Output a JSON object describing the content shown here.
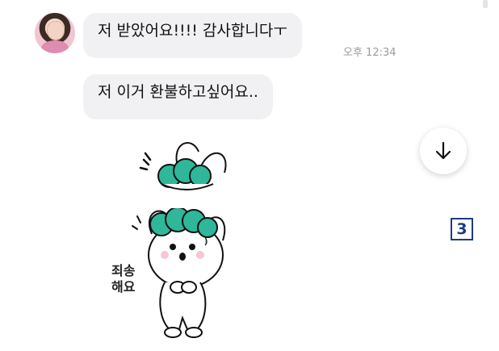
{
  "messages": [
    {
      "text": "저 받았어요!!!! 감사합니다ㅜ"
    },
    {
      "text": "저 이거 환불하고싶어요.."
    }
  ],
  "timestamp": "오후 12:34",
  "sticker": {
    "caption_line1": "죄송",
    "caption_line2": "해요"
  },
  "page_badge": "3",
  "icons": {
    "avatar": "user-avatar",
    "scroll_down": "arrow-down-icon",
    "sticker": "bunny-sticker"
  },
  "colors": {
    "bubble": "#f1f1f3",
    "sticker_hair": "#2fb79a",
    "badge": "#1e3a8a"
  }
}
